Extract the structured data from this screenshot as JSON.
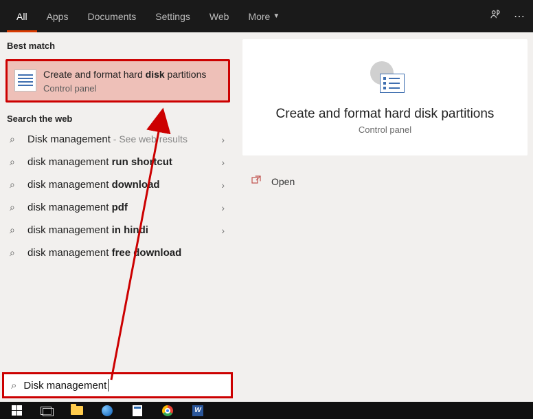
{
  "tabs": {
    "all": "All",
    "apps": "Apps",
    "documents": "Documents",
    "settings": "Settings",
    "web": "Web",
    "more": "More"
  },
  "top_icons": {
    "feedback": "feedback",
    "ellipsis": "more-options"
  },
  "left": {
    "best_header": "Best match",
    "best": {
      "title_pre": "Create and format hard ",
      "title_bold": "disk",
      "title_post": " partitions",
      "subtitle": "Control panel"
    },
    "web_header": "Search the web",
    "items": [
      {
        "pre": "Disk management",
        "bold": "",
        "extra": " - See web results"
      },
      {
        "pre": "disk management ",
        "bold": "run shortcut",
        "extra": ""
      },
      {
        "pre": "disk management ",
        "bold": "download",
        "extra": ""
      },
      {
        "pre": "disk management ",
        "bold": "pdf",
        "extra": ""
      },
      {
        "pre": "disk management ",
        "bold": "in hindi",
        "extra": ""
      },
      {
        "pre": "disk management ",
        "bold": "free download",
        "extra": ""
      }
    ]
  },
  "right": {
    "title": "Create and format hard disk partitions",
    "subtitle": "Control panel",
    "actions": {
      "open": "Open"
    }
  },
  "search": {
    "value": "Disk management"
  },
  "taskbar": {
    "word_glyph": "W"
  }
}
